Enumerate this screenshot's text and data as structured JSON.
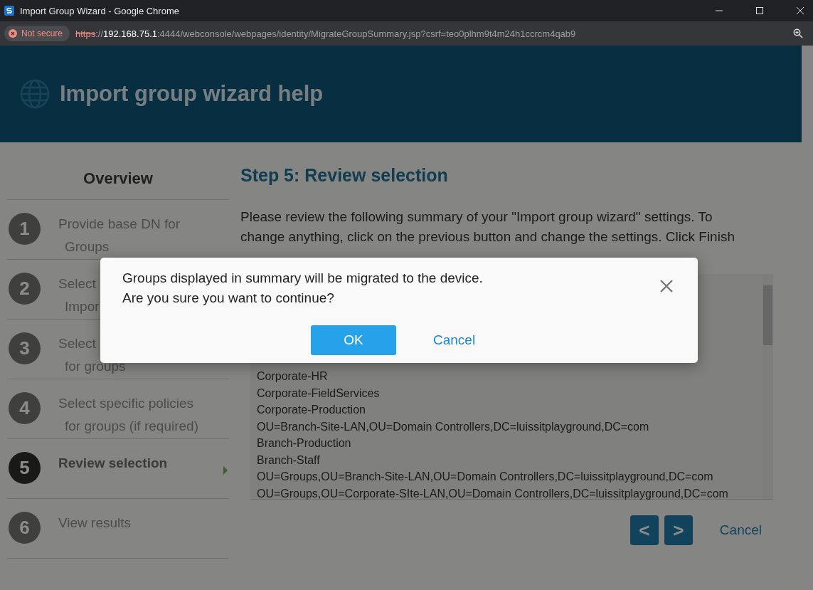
{
  "window": {
    "title": "Import Group Wizard - Google Chrome"
  },
  "address_bar": {
    "security": "Not secure",
    "scheme": "https",
    "separator": "://",
    "host": "192.168.75.1",
    "rest": ":4444/webconsole/webpages/identity/MigrateGroupSummary.jsp?csrf=teo0plhm9t4m24h1ccrcm4qab9"
  },
  "header": {
    "title": "Import group wizard help"
  },
  "sidebar": {
    "title": "Overview",
    "steps": [
      {
        "number": "1",
        "lines": [
          "Provide base DN for",
          "Groups"
        ],
        "selected": false
      },
      {
        "number": "2",
        "lines": [
          "Select",
          "Impor"
        ],
        "selected": false
      },
      {
        "number": "3",
        "lines": [
          "Select",
          "for groups"
        ],
        "selected": false
      },
      {
        "number": "4",
        "lines": [
          "Select specific policies",
          "for groups (if required)"
        ],
        "selected": false
      },
      {
        "number": "5",
        "lines": [
          "Review selection"
        ],
        "selected": true
      },
      {
        "number": "6",
        "lines": [
          "View results"
        ],
        "selected": false
      }
    ]
  },
  "main": {
    "title": "Step 5: Review selection",
    "intro": [
      "Please review the following summary of your \"Import group wizard\" settings. To",
      "change anything, click on the previous button and change the settings. Click Finish"
    ],
    "summary": [
      "Corporate-HR",
      "Corporate-FieldServices",
      "Corporate-Production",
      "OU=Branch-Site-LAN,OU=Domain Controllers,DC=luissitplayground,DC=com",
      "Branch-Production",
      "Branch-Staff",
      "OU=Groups,OU=Branch-Site-LAN,OU=Domain Controllers,DC=luissitplayground,DC=com",
      "OU=Groups,OU=Corporate-SIte-LAN,OU=Domain Controllers,DC=luissitplayground,DC=com"
    ],
    "previous": "<",
    "next": ">",
    "cancel": "Cancel"
  },
  "dialog": {
    "message": [
      "Groups displayed in summary will be migrated to the device.",
      "Are you sure you want to continue?"
    ],
    "ok": "OK",
    "cancel": "Cancel"
  }
}
